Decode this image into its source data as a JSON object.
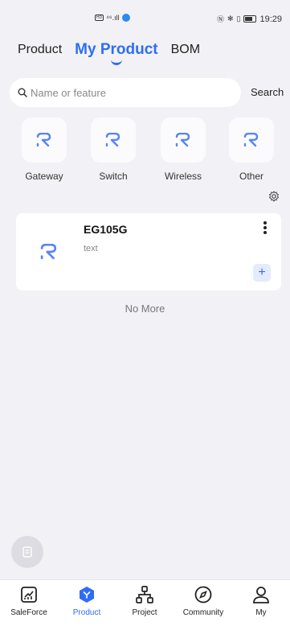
{
  "status_bar": {
    "left_icons": "HD ⁴⁶.ıll",
    "right_icons": "NFC ✻ ⃝ ıll",
    "time": "19:29"
  },
  "tabs": [
    {
      "label": "Product",
      "active": false
    },
    {
      "label": "My Product",
      "active": true
    },
    {
      "label": "BOM",
      "active": false
    }
  ],
  "search": {
    "placeholder": "Name or feature",
    "button_label": "Search"
  },
  "categories": [
    {
      "label": "Gateway",
      "icon": "brand-logo-icon"
    },
    {
      "label": "Switch",
      "icon": "brand-logo-icon"
    },
    {
      "label": "Wireless",
      "icon": "brand-logo-icon"
    },
    {
      "label": "Other",
      "icon": "brand-logo-icon"
    }
  ],
  "products": [
    {
      "name": "EG105G",
      "description": "text"
    }
  ],
  "list_footer": "No More",
  "bottom_nav": [
    {
      "label": "SaleForce",
      "icon": "chart-icon",
      "active": false
    },
    {
      "label": "Product",
      "icon": "product-cube-icon",
      "active": true
    },
    {
      "label": "Project",
      "icon": "network-icon",
      "active": false
    },
    {
      "label": "Community",
      "icon": "compass-icon",
      "active": false
    },
    {
      "label": "My",
      "icon": "person-icon",
      "active": false
    }
  ],
  "colors": {
    "accent": "#2e6df6",
    "background": "#f2f2f6",
    "logo": "#5b84f2"
  }
}
